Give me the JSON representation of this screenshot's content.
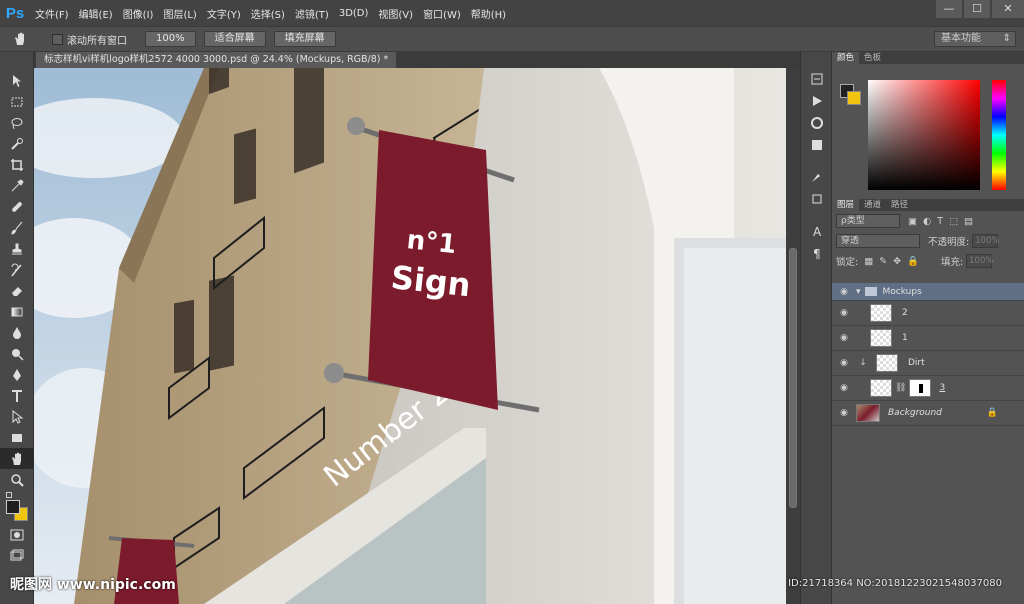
{
  "app": {
    "logo": "Ps"
  },
  "menu": [
    "文件(F)",
    "编辑(E)",
    "图像(I)",
    "图层(L)",
    "文字(Y)",
    "选择(S)",
    "滤镜(T)",
    "3D(D)",
    "视图(V)",
    "窗口(W)",
    "帮助(H)"
  ],
  "window_controls": {
    "minimize": "—",
    "maximize": "☐",
    "close": "✕"
  },
  "options_bar": {
    "scroll_all_label": "滚动所有窗口",
    "zoom100_label": "100%",
    "fit_screen_label": "适合屏幕",
    "fill_screen_label": "填充屏幕",
    "workspace": "基本功能"
  },
  "document": {
    "tab_title": "标志样机vi样机logo样机2572 4000 3000.psd @ 24.4% (Mockups, RGB/8) *"
  },
  "canvas_text": {
    "banner_line1": "n°1",
    "banner_line2": "Sign",
    "wall_text": "Number 2"
  },
  "color_panel": {
    "tabs": [
      "颜色",
      "色板"
    ]
  },
  "layers_panel": {
    "tabs": [
      "图层",
      "通道",
      "路径"
    ],
    "filter_label": "ρ类型",
    "blend_mode": "穿透",
    "opacity_label": "不透明度:",
    "opacity_value": "100%",
    "lock_label": "锁定:",
    "fill_label": "填充:",
    "fill_value": "100%",
    "layers": [
      {
        "name": "Mockups",
        "type": "group"
      },
      {
        "name": "2",
        "type": "smart"
      },
      {
        "name": "1",
        "type": "smart"
      },
      {
        "name": "Dirt",
        "type": "clipped"
      },
      {
        "name": "3",
        "type": "masked"
      },
      {
        "name": "Background",
        "type": "background"
      }
    ]
  },
  "watermark": {
    "left": "昵图网 www.nipic.com",
    "right": "ID:21718364 NO:20181223021548037080"
  },
  "colors": {
    "accent": "#31a8ff",
    "banner": "#7c1b2c",
    "panel_bg": "#535353"
  }
}
